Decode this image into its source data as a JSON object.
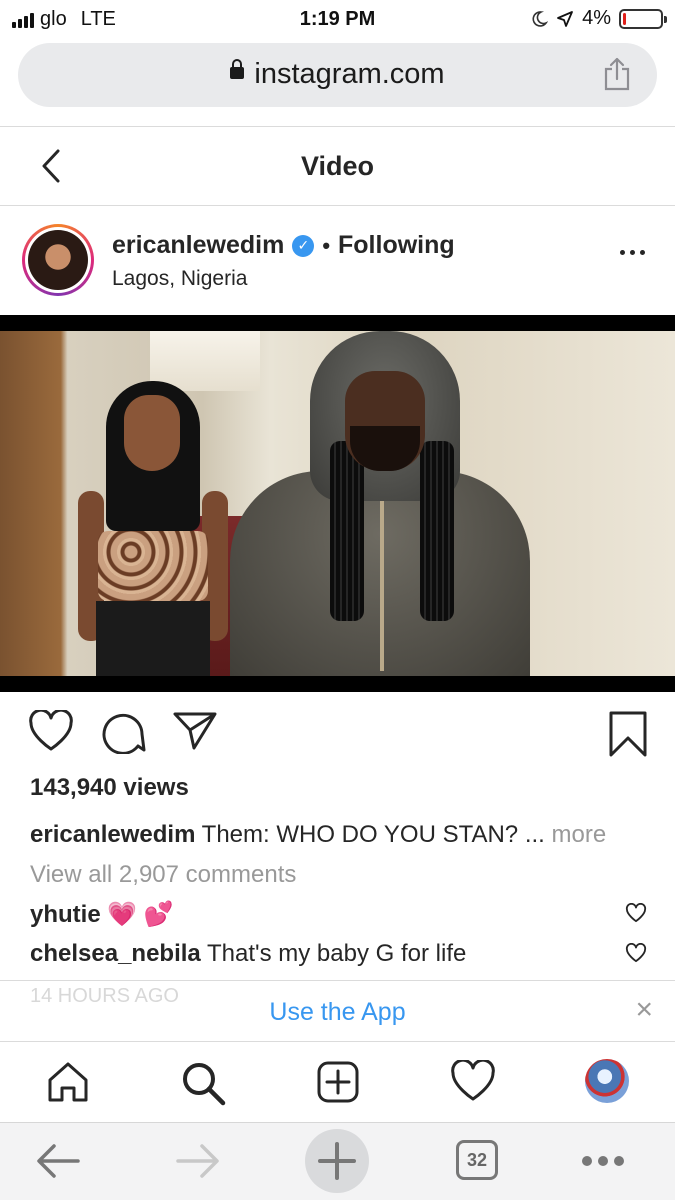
{
  "status_bar": {
    "carrier": "glo",
    "network": "LTE",
    "time": "1:19 PM",
    "battery": "4%",
    "battery_level": 0.04
  },
  "browser": {
    "url": "instagram.com"
  },
  "header": {
    "title": "Video"
  },
  "post": {
    "username": "ericanlewedim",
    "follow_status": "Following",
    "dot": "•",
    "location": "Lagos, Nigeria",
    "views": "143,940 views",
    "caption_user": "ericanlewedim",
    "caption_text": "Them: WHO DO YOU STAN? ...",
    "caption_more": "more",
    "view_all_comments": "View all 2,907 comments",
    "comments": [
      {
        "user": "yhutie",
        "text": "💗 💕"
      },
      {
        "user": "chelsea_nebila",
        "text": "That's my baby G for life"
      }
    ]
  },
  "banner": {
    "ghost_text": "14 HOURS AGO",
    "label": "Use the App",
    "close": "×"
  },
  "safari": {
    "tab_count": "32"
  },
  "icons": {
    "verified": "verified-badge-icon",
    "like": "heart-icon",
    "comment": "comment-icon",
    "share": "paper-plane-icon",
    "save": "bookmark-icon"
  },
  "colors": {
    "link_blue": "#3897f0",
    "muted": "#999999",
    "battery_low": "#e0201b"
  }
}
